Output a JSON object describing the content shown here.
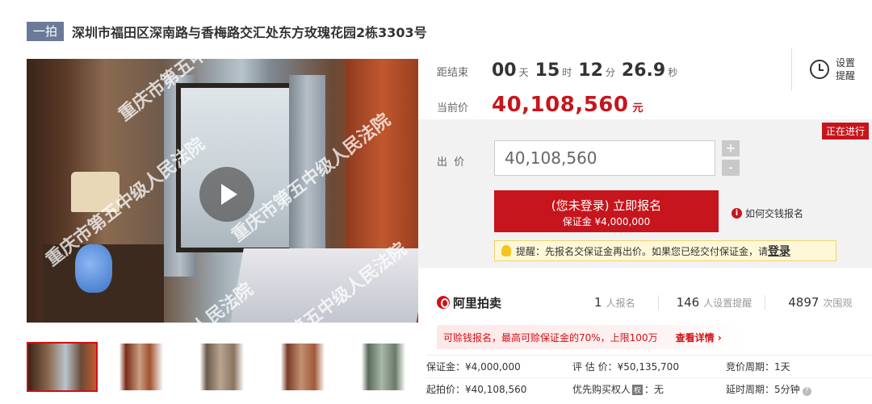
{
  "header": {
    "tag": "一拍",
    "title": "深圳市福田区深南路与香梅路交汇处东方玫瑰花园2栋3303号"
  },
  "media": {
    "watermark": "重庆市第五中级人民法院",
    "play_icon": "play-icon"
  },
  "thumbnails": [
    {
      "icon": "thumb-photo-1",
      "active": true
    },
    {
      "icon": "thumb-photo-2",
      "active": false
    },
    {
      "icon": "thumb-photo-3",
      "active": false
    },
    {
      "icon": "thumb-photo-4",
      "active": false
    },
    {
      "icon": "thumb-photo-5",
      "active": false
    }
  ],
  "countdown": {
    "label": "距结束",
    "days": "00",
    "days_unit": "天",
    "hours": "15",
    "hours_unit": "时",
    "minutes": "12",
    "minutes_unit": "分",
    "seconds": "26.9",
    "seconds_unit": "秒"
  },
  "reminder": {
    "label": "设置提醒",
    "icon": "clock-icon"
  },
  "current_price": {
    "label": "当前价",
    "value": "40,108,560",
    "unit": "元"
  },
  "bid": {
    "status": "正在进行",
    "label": "出  价",
    "input_value": "40,108,560",
    "plus": "+",
    "minus": "-",
    "signup_main": "(您未登录) 立即报名",
    "signup_sub": "保证金 ¥4,000,000",
    "howto": "如何交钱报名",
    "tip_text": "提醒：先报名交保证金再出价。如果您已经交付保证金，请",
    "tip_login": "登录"
  },
  "stats": {
    "logo": "阿里拍卖",
    "signups_num": "1",
    "signups_label": "人报名",
    "reminders_num": "146",
    "reminders_label": "人设置提醒",
    "views_num": "4897",
    "views_label": "次围观"
  },
  "pledge": {
    "text": "可赊钱报名，最高可赊保证金的70%，上限100万",
    "link": "查看详情 ›"
  },
  "details": {
    "deposit": "保证金：¥4,000,000",
    "appraisal": "评 估 价：¥50,135,700",
    "cycle": "竞价周期：1天",
    "start_price": "起拍价：¥40,108,560",
    "priority_prefix": "优先购买权人",
    "priority_icon_text": "权",
    "priority_suffix": "：无",
    "delay": "延时周期：5分钟"
  },
  "colors": {
    "accent": "#c6151c",
    "tag_bg": "#6b7a99",
    "panel_bg": "#f2f2f2"
  }
}
